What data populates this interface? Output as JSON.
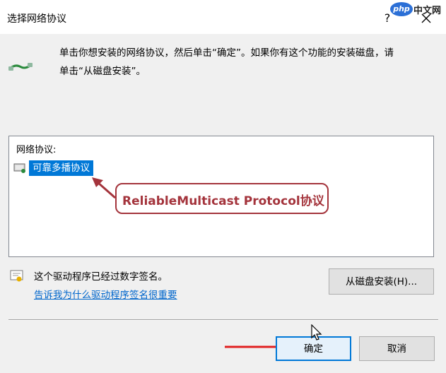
{
  "window": {
    "title": "选择网络协议",
    "help_label": "?",
    "close_icon": "close-icon"
  },
  "watermark": {
    "logo": "php",
    "text": "中文网"
  },
  "instruction": {
    "line1": "单击你想安装的网络协议，然后单击“确定”。如果你有这个功能的安装磁盘，请",
    "line2": "单击“从磁盘安装”。"
  },
  "protocol_list": {
    "label": "网络协议:",
    "items": [
      {
        "label": "可靠多播协议",
        "selected": true,
        "icon": "protocol-icon"
      }
    ]
  },
  "annotation": {
    "text": "ReliableMulticast Protocol协议",
    "color": "#a4343c"
  },
  "driver": {
    "signed_text": "这个驱动程序已经过数字签名。",
    "why_link": "告诉我为什么驱动程序签名很重要",
    "icon": "certificate-icon"
  },
  "buttons": {
    "have_disk": "从磁盘安装(H)...",
    "ok": "确定",
    "cancel": "取消"
  },
  "colors": {
    "selection": "#0078d7",
    "link": "#0066cc",
    "dialog_bg": "#f0f0f0",
    "arrow": "#e02020"
  }
}
